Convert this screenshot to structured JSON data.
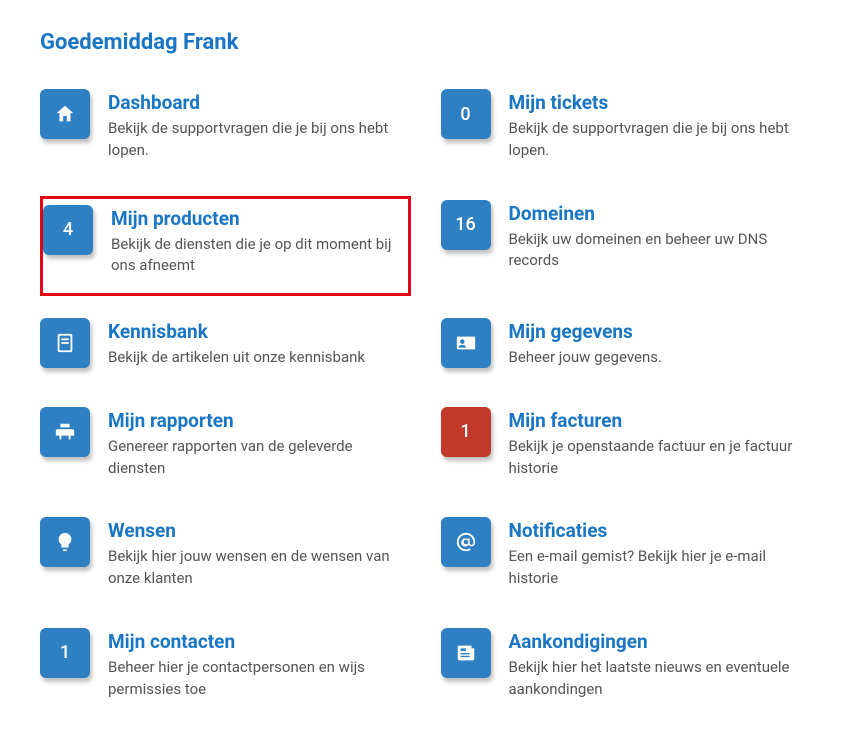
{
  "greeting": "Goedemiddag Frank",
  "colors": {
    "primary": "#2f80c2",
    "title": "#1976c5",
    "danger": "#c0392b",
    "highlight": "#e30613"
  },
  "cards": [
    {
      "id": "dashboard",
      "badge_type": "icon",
      "icon": "home-icon",
      "title": "Dashboard",
      "desc": "Bekijk de supportvragen die je bij ons hebt lopen."
    },
    {
      "id": "tickets",
      "badge_type": "count",
      "count": "0",
      "title": "Mijn tickets",
      "desc": "Bekijk de supportvragen die je bij ons hebt lopen."
    },
    {
      "id": "products",
      "badge_type": "count",
      "count": "4",
      "highlight": true,
      "title": "Mijn producten",
      "desc": "Bekijk de diensten die je op dit moment bij ons afneemt"
    },
    {
      "id": "domains",
      "badge_type": "count",
      "count": "16",
      "title": "Domeinen",
      "desc": "Bekijk uw domeinen en beheer uw DNS records"
    },
    {
      "id": "kb",
      "badge_type": "icon",
      "icon": "book-icon",
      "title": "Kennisbank",
      "desc": "Bekijk de artikelen uit onze kennisbank"
    },
    {
      "id": "mydata",
      "badge_type": "icon",
      "icon": "id-card-icon",
      "title": "Mijn gegevens",
      "desc": "Beheer jouw gegevens."
    },
    {
      "id": "reports",
      "badge_type": "icon",
      "icon": "print-icon",
      "title": "Mijn rapporten",
      "desc": "Genereer rapporten van de geleverde diensten"
    },
    {
      "id": "invoices",
      "badge_type": "count",
      "count": "1",
      "danger": true,
      "title": "Mijn facturen",
      "desc": "Bekijk je openstaande factuur en je factuur historie"
    },
    {
      "id": "wishes",
      "badge_type": "icon",
      "icon": "bulb-icon",
      "title": "Wensen",
      "desc": "Bekijk hier jouw wensen en de wensen van onze klanten"
    },
    {
      "id": "notifications",
      "badge_type": "icon",
      "icon": "at-icon",
      "title": "Notificaties",
      "desc": "Een e-mail gemist? Bekijk hier je e-mail historie"
    },
    {
      "id": "contacts",
      "badge_type": "count",
      "count": "1",
      "title": "Mijn contacten",
      "desc": "Beheer hier je contactpersonen en wijs permissies toe"
    },
    {
      "id": "announcements",
      "badge_type": "icon",
      "icon": "news-icon",
      "title": "Aankondigingen",
      "desc": "Bekijk hier het laatste nieuws en eventuele aankondingen"
    }
  ]
}
